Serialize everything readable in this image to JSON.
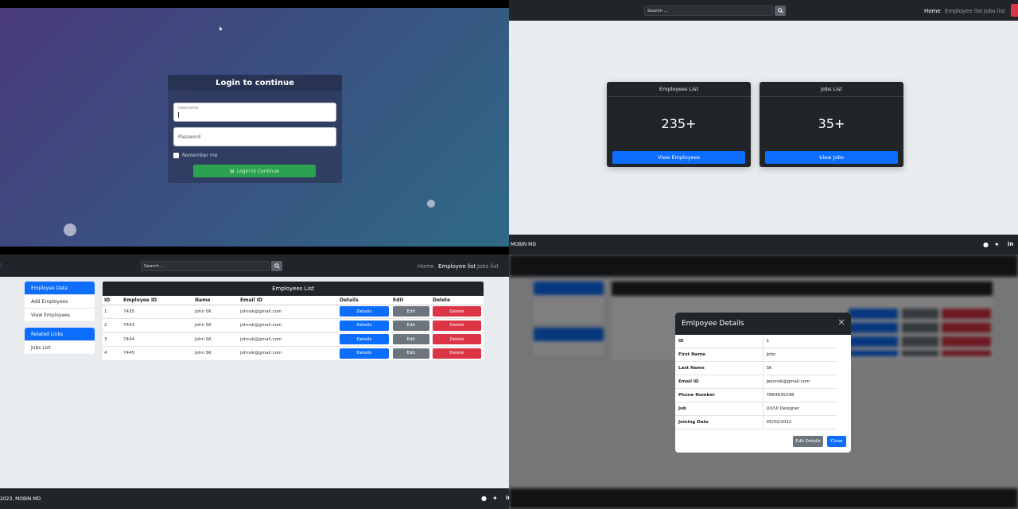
{
  "login": {
    "title": "Login to continue",
    "username_label": "Username",
    "password_placeholder": "Password",
    "remember_label": "Remember me",
    "submit_label": "Login to Continue"
  },
  "nav": {
    "search_placeholder": "Search ...",
    "links": [
      "Home",
      "Employee list",
      "Jobs list"
    ]
  },
  "dashboard": {
    "cards": [
      {
        "title": "Employees List",
        "count": "235+",
        "button": "View Employees"
      },
      {
        "title": "Jobs List",
        "count": "35+",
        "button": "View Jobs"
      }
    ],
    "footer_text": "MOBIN MD"
  },
  "employees": {
    "sidebar": {
      "group1": [
        "Employee Data",
        "Add Employees",
        "View Employees"
      ],
      "group2": [
        "Related Links",
        "Jobs List"
      ]
    },
    "table_title": "Employees List",
    "columns": [
      "ID",
      "Employee ID",
      "Name",
      "Email ID",
      "Details",
      "Edit",
      "Delete"
    ],
    "rows": [
      {
        "id": "1",
        "emp_id": "7435",
        "name": "John SK",
        "email": "johnsk@gmail.com"
      },
      {
        "id": "2",
        "emp_id": "7443",
        "name": "John SK",
        "email": "johnsk@gmail.com"
      },
      {
        "id": "3",
        "emp_id": "7444",
        "name": "John SK",
        "email": "johnsk@gmail.com"
      },
      {
        "id": "4",
        "emp_id": "7445",
        "name": "John SK",
        "email": "johnsk@gmail.com"
      }
    ],
    "btn_details": "Details",
    "btn_edit": "Edit",
    "btn_delete": "Delete",
    "footer_text": "2023, MOBIN MD"
  },
  "modal": {
    "title": "Emlpoyee Details",
    "fields": [
      {
        "k": "ID",
        "v": "1"
      },
      {
        "k": "First Name",
        "v": "John"
      },
      {
        "k": "Last Name",
        "v": "SK"
      },
      {
        "k": "Email ID",
        "v": "jasonsk@gmail.com"
      },
      {
        "k": "Phone Number",
        "v": "7864635248"
      },
      {
        "k": "Job",
        "v": "UX/UI Designer"
      },
      {
        "k": "Joining Date",
        "v": "05/02/2022"
      }
    ],
    "edit_label": "Edit Details",
    "close_label": "Close"
  },
  "colors": {
    "primary": "#0d6efd",
    "success": "#2aa24f",
    "danger": "#dc3545",
    "secondary": "#6c757d",
    "dark": "#212529"
  }
}
